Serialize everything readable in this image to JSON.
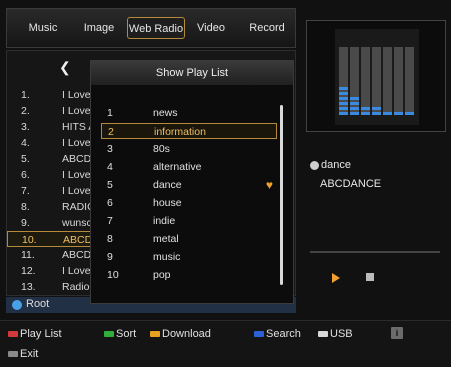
{
  "tabs": [
    {
      "label": "Music",
      "active": false
    },
    {
      "label": "Image",
      "active": false
    },
    {
      "label": "Web Radio",
      "active": true
    },
    {
      "label": "Video",
      "active": false
    },
    {
      "label": "Record",
      "active": false
    }
  ],
  "list": {
    "rows": [
      {
        "num": "1.",
        "name": "I Love I"
      },
      {
        "num": "2.",
        "name": "I Love I"
      },
      {
        "num": "3.",
        "name": "HITS A"
      },
      {
        "num": "4.",
        "name": "I Love 2"
      },
      {
        "num": "5.",
        "name": "ABCDA"
      },
      {
        "num": "6.",
        "name": "I Love I"
      },
      {
        "num": "7.",
        "name": "I Love I"
      },
      {
        "num": "8.",
        "name": "RADIO"
      },
      {
        "num": "9.",
        "name": "wunscl"
      },
      {
        "num": "10.",
        "name": "ABCDA",
        "highlighted": true
      },
      {
        "num": "11.",
        "name": "ABCDE"
      },
      {
        "num": "12.",
        "name": "I Love I"
      },
      {
        "num": "13.",
        "name": "Radio I"
      }
    ]
  },
  "root": {
    "label": "Root"
  },
  "popup": {
    "title": "Show Play List",
    "items": [
      {
        "num": "1",
        "name": "news"
      },
      {
        "num": "2",
        "name": "information",
        "highlighted": true
      },
      {
        "num": "3",
        "name": "80s"
      },
      {
        "num": "4",
        "name": "alternative"
      },
      {
        "num": "5",
        "name": "dance",
        "favorite": true
      },
      {
        "num": "6",
        "name": "house"
      },
      {
        "num": "7",
        "name": "indie"
      },
      {
        "num": "8",
        "name": "metal"
      },
      {
        "num": "9",
        "name": "music"
      },
      {
        "num": "10",
        "name": "pop"
      }
    ]
  },
  "now_playing": {
    "genre": "dance",
    "station": "ABCDANCE",
    "controls": {
      "play_icon": "play-icon",
      "stop_icon": "stop-icon"
    }
  },
  "visualizer": {
    "levels": [
      6,
      4,
      2,
      2,
      1,
      1,
      1
    ]
  },
  "footer": {
    "keys": [
      {
        "label": "Play List",
        "color": "#d23a3a"
      },
      {
        "label": "Sort",
        "color": "#2fae3a"
      },
      {
        "label": "Download",
        "color": "#e6a21e"
      },
      {
        "label": "Search",
        "color": "#2a62d6"
      },
      {
        "label": "USB",
        "color": "#d8d8d8"
      },
      {
        "label": "Exit",
        "color": "#8a8a8a"
      }
    ],
    "info_key": {
      "label": "i"
    }
  },
  "colors": {
    "highlight": "#f0c060",
    "accent": "#f0a030",
    "visualizer": "#3a8be0"
  }
}
